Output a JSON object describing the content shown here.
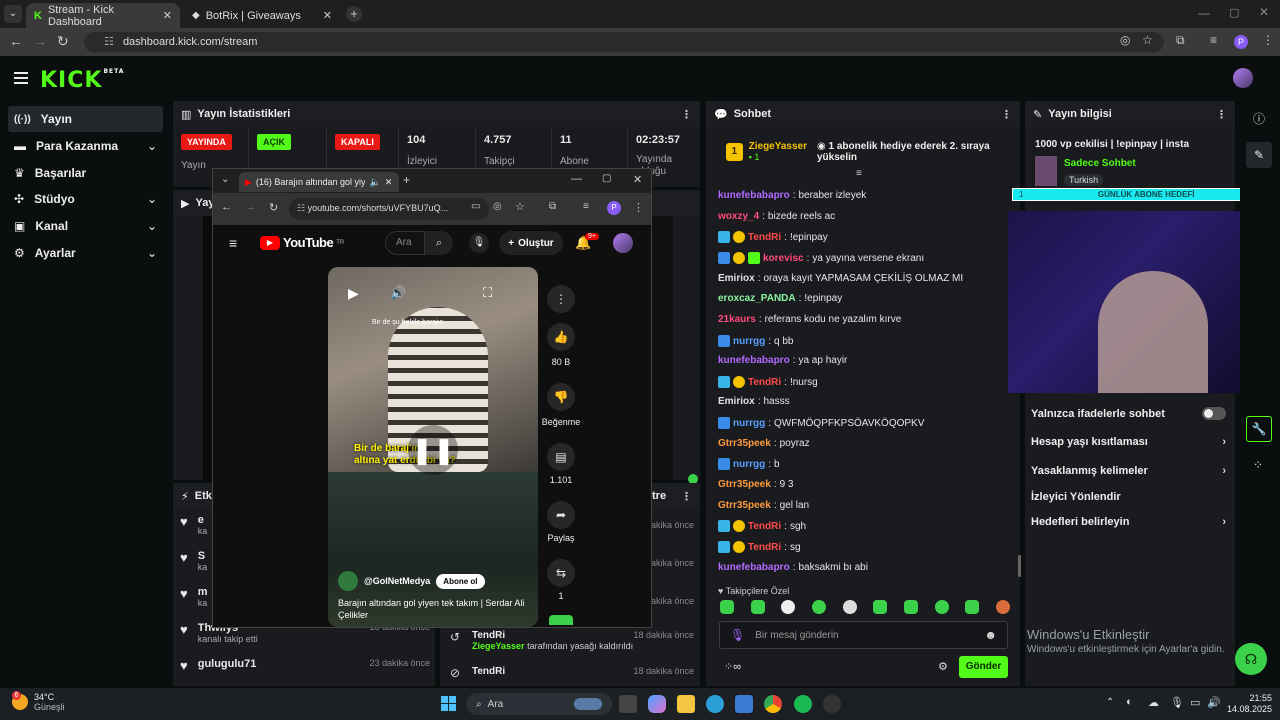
{
  "browser": {
    "tabs": [
      {
        "label": "Stream - Kick Dashboard",
        "active": true
      },
      {
        "label": "BotRix | Giveaways",
        "active": false
      }
    ],
    "url": "dashboard.kick.com/stream",
    "profile_initial": "P"
  },
  "kick": {
    "logo": "KICK",
    "logo_badge": "BETA"
  },
  "sidebar": {
    "items": [
      {
        "label": "Yayın",
        "icon": "broadcast-icon",
        "active": true,
        "chevron": false
      },
      {
        "label": "Para Kazanma",
        "icon": "money-icon",
        "active": false,
        "chevron": true
      },
      {
        "label": "Başarılar",
        "icon": "trophy-icon",
        "active": false,
        "chevron": false
      },
      {
        "label": "Stüdyo",
        "icon": "studio-icon",
        "active": false,
        "chevron": true
      },
      {
        "label": "Kanal",
        "icon": "channel-icon",
        "active": false,
        "chevron": true
      },
      {
        "label": "Ayarlar",
        "icon": "gear-icon",
        "active": false,
        "chevron": true
      }
    ]
  },
  "stats": {
    "title": "Yayın İstatistikleri",
    "status_live": "YAYINDA",
    "status_open": "AÇIK",
    "status_closed": "KAPALI",
    "status_sub": "Yayın",
    "viewers_value": "104",
    "viewers_label": "İzleyici",
    "followers_value": "4.757",
    "followers_label": "Takipçi",
    "subs_value": "11",
    "subs_label": "Abone",
    "duration_value": "02:23:57",
    "duration_label": "Yayında",
    "duration_label2": "olduğu"
  },
  "preview_panel": {
    "title": "Yayı"
  },
  "activity": {
    "title": "Etkin",
    "items": [
      {
        "name": "e",
        "sub": "ka",
        "time": ""
      },
      {
        "name": "S",
        "sub": "ka",
        "time": ""
      },
      {
        "name": "m",
        "sub": "ka",
        "time": ""
      },
      {
        "name": "Thwilys",
        "sub": "kanalı takip etti",
        "time": "18 dakika önce"
      },
      {
        "name": "gulugulu71",
        "sub": "",
        "time": "23 dakika önce"
      }
    ]
  },
  "mod_actions": {
    "title": "tre",
    "items": [
      {
        "time": "dakika önce"
      },
      {
        "time": "dakika önce"
      },
      {
        "time": "dakika önce"
      },
      {
        "name": "TendRi",
        "detail_user": "ZiegeYasser",
        "detail": "tarafından yasağı kaldırıldı",
        "time": "18 dakika önce"
      },
      {
        "name": "TendRi",
        "detail_user": "",
        "detail": "",
        "time": "18 dakika önce"
      }
    ]
  },
  "chat": {
    "title": "Sohbet",
    "pinned_user": "ZiegeYasser",
    "pinned_count": "1",
    "pinned_badge": "1",
    "pinned_text": "1 abonelik hediye ederek 2. sıraya yükselin",
    "messages": [
      {
        "user": "kunefebabapro",
        "color": "#b36bff",
        "text": "beraber izleyek",
        "badges": 0
      },
      {
        "user": "woxzy_4",
        "color": "#ff4b7d",
        "text": "bizede reels ac",
        "badges": 0
      },
      {
        "user": "TendRi",
        "color": "#ff4b4b",
        "text": "!epinpay",
        "badges": 2
      },
      {
        "user": "korevisc",
        "color": "#ff4b7d",
        "text": "ya yayına versene ekranı",
        "badges": 3
      },
      {
        "user": "Emiriox",
        "color": "#e0e0e0",
        "text": "oraya kayıt YAPMASAM ÇEKİLİŞ OLMAZ MI",
        "badges": 0
      },
      {
        "user": "eroxcaz_PANDA",
        "color": "#8cf2a0",
        "text": "!epinpay",
        "badges": 0
      },
      {
        "user": "21kaurs",
        "color": "#ff4b7d",
        "text": "referans kodu ne yazalım kırve",
        "badges": 0
      },
      {
        "user": "nurrgg",
        "color": "#5aa0ff",
        "text": "q bb",
        "badges": 1
      },
      {
        "user": "kunefebabapro",
        "color": "#b36bff",
        "text": "ya ap hayir",
        "badges": 0
      },
      {
        "user": "TendRi",
        "color": "#ff4b4b",
        "text": "!nursg",
        "badges": 2
      },
      {
        "user": "Emiriox",
        "color": "#e0e0e0",
        "text": "hasss",
        "badges": 0
      },
      {
        "user": "nurrgg",
        "color": "#5aa0ff",
        "text": "QWFMÖQPFKPSÖAVKÖQOPKV",
        "badges": 1
      },
      {
        "user": "Gtrr35peek",
        "color": "#ff9a3c",
        "text": "poyraz",
        "badges": 0
      },
      {
        "user": "nurrgg",
        "color": "#5aa0ff",
        "text": "b",
        "badges": 1
      },
      {
        "user": "Gtrr35peek",
        "color": "#ff9a3c",
        "text": "9 3",
        "badges": 0
      },
      {
        "user": "Gtrr35peek",
        "color": "#ff9a3c",
        "text": "gel lan",
        "badges": 0
      },
      {
        "user": "TendRi",
        "color": "#ff4b4b",
        "text": "sgh",
        "badges": 2
      },
      {
        "user": "TendRi",
        "color": "#ff4b4b",
        "text": "sg",
        "badges": 2
      },
      {
        "user": "kunefebabapro",
        "color": "#b36bff",
        "text": "baksakmi bı abi",
        "badges": 0
      }
    ],
    "emote_section": "Takipçilere Özel",
    "input_placeholder": "Bir mesaj gönderin",
    "send_label": "Gönder"
  },
  "stream_info": {
    "title": "Yayın bilgisi",
    "stream_title": "1000 vp cekilisi | !epinpay | insta",
    "streamer_label": "Sadece Sohbet",
    "language": "Turkish",
    "goal_label": "GÜNLÜK ABONE HEDEFİ",
    "goal_progress": "1",
    "settings": [
      {
        "label": "Yalnızca ifadelerle sohbet",
        "type": "toggle"
      },
      {
        "label": "Hesap yaşı kısıtlaması",
        "type": "chevron"
      },
      {
        "label": "Yasaklanmış kelimeler",
        "type": "chevron"
      },
      {
        "label": "İzleyici Yönlendir",
        "type": "none"
      },
      {
        "label": "Hedefleri belirleyin",
        "type": "chevron"
      }
    ]
  },
  "watermark": {
    "title": "Windows'u Etkinleştir",
    "sub": "Windows'u etkinleştirmek için Ayarlar'a gidin."
  },
  "popup": {
    "tab_label": "(16) Barajın altından gol yiy",
    "url": "youtube.com/shorts/uVFYBU7uQ...",
    "yt_logo": "YouTube",
    "yt_region": "TR",
    "search_placeholder": "Ara",
    "create_label": "Oluştur",
    "notif_count": "9+",
    "caption_top": "Bir de şu frekile barajın",
    "caption_main1": "Bir de",
    "caption_main2": "baraj'ın",
    "caption_main3": "altına yat",
    "caption_main4": "erdi abi ya?",
    "like_count": "80 B",
    "dislike_label": "Beğenme",
    "comment_count": "1.101",
    "share_label": "Paylaş",
    "remix_count": "1",
    "channel": "@GolNetMedya",
    "subscribe_label": "Abone ol",
    "video_title": "Barajın altından gol yiyen tek takım | Serdar Ali Çelikler"
  },
  "taskbar": {
    "weather_temp": "34°C",
    "weather_desc": "Güneşli",
    "weather_badge": "6",
    "search_label": "Ara",
    "time": "21:55",
    "date": "14.08.2025"
  },
  "colors": {
    "kick_green": "#53fc18",
    "live_red": "#e91916",
    "goal_cyan": "#17e9ee"
  }
}
